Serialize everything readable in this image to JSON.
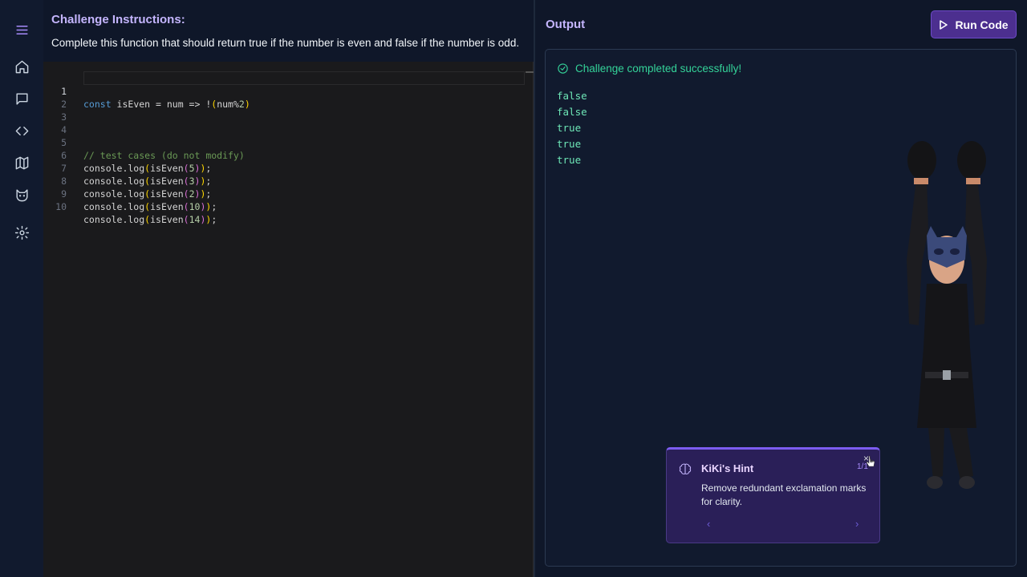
{
  "challenge": {
    "title": "Challenge Instructions:",
    "description": "Complete this function that should return true if the number is even and false if the number is odd."
  },
  "editor": {
    "line_numbers": [
      "1",
      "2",
      "3",
      "4",
      "5",
      "6",
      "7",
      "8",
      "9",
      "10"
    ],
    "lines": {
      "l1": {
        "kw": "const",
        "rest": " isEven = num => !",
        "p1": "(",
        "a": "num",
        "op": "%",
        "n": "2",
        "p2": ")"
      },
      "l5": "// test cases (do not modify)",
      "calls": [
        {
          "pre": "console.log",
          "o1": "(",
          "fn": "isEven",
          "o2": "(",
          "n": "5",
          "c2": ")",
          "c1": ")",
          "semi": ";"
        },
        {
          "pre": "console.log",
          "o1": "(",
          "fn": "isEven",
          "o2": "(",
          "n": "3",
          "c2": ")",
          "c1": ")",
          "semi": ";"
        },
        {
          "pre": "console.log",
          "o1": "(",
          "fn": "isEven",
          "o2": "(",
          "n": "2",
          "c2": ")",
          "c1": ")",
          "semi": ";"
        },
        {
          "pre": "console.log",
          "o1": "(",
          "fn": "isEven",
          "o2": "(",
          "n": "10",
          "c2": ")",
          "c1": ")",
          "semi": ";"
        },
        {
          "pre": "console.log",
          "o1": "(",
          "fn": "isEven",
          "o2": "(",
          "n": "14",
          "c2": ")",
          "c1": ")",
          "semi": ";"
        }
      ]
    }
  },
  "output": {
    "title": "Output",
    "run_label": "Run Code",
    "success": "Challenge completed successfully!",
    "lines": [
      "false",
      "false",
      "true",
      "true",
      "true"
    ]
  },
  "hint": {
    "title": "KiKi's Hint",
    "count": "1/1",
    "close": "×",
    "text": "Remove redundant exclamation marks for clarity.",
    "prev": "‹",
    "next": "›"
  },
  "sidebar": {
    "items": [
      "menu-icon",
      "home-icon",
      "chat-icon",
      "code-icon",
      "map-icon",
      "cat-icon",
      "settings-icon"
    ]
  },
  "colors": {
    "accent": "#a78bfa",
    "success": "#34d399",
    "run_button": "#4c2f8f",
    "hint_border": "#7c5cf0"
  }
}
